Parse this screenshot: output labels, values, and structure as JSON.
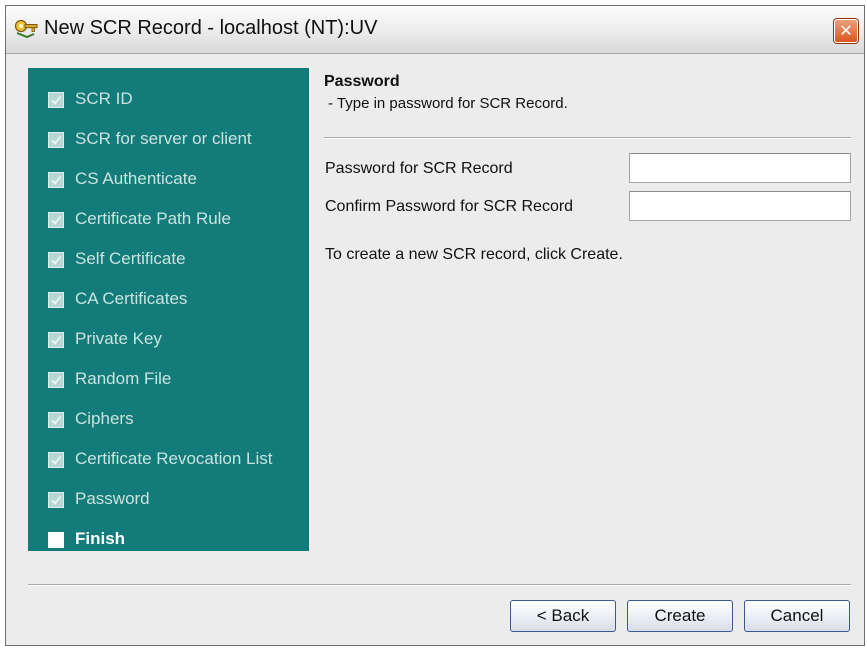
{
  "window": {
    "title": "New SCR Record - localhost (NT):UV",
    "close_glyph": "✕"
  },
  "icons": {
    "app": "key-icon",
    "close": "close-icon",
    "checkbox": "checkmark-icon"
  },
  "colors": {
    "steps_panel": "#137c7a",
    "close_button": "#d9541f",
    "button_border": "#3a5a92"
  },
  "steps": [
    {
      "label": "SCR ID",
      "checked": true
    },
    {
      "label": "SCR for server or client",
      "checked": true
    },
    {
      "label": "CS Authenticate",
      "checked": true
    },
    {
      "label": "Certificate Path Rule",
      "checked": true
    },
    {
      "label": "Self Certificate",
      "checked": true
    },
    {
      "label": "CA Certificates",
      "checked": true
    },
    {
      "label": "Private Key",
      "checked": true
    },
    {
      "label": "Random File",
      "checked": true
    },
    {
      "label": "Ciphers",
      "checked": true
    },
    {
      "label": "Certificate Revocation List",
      "checked": true
    },
    {
      "label": "Password",
      "checked": true
    },
    {
      "label": "Finish",
      "checked": false
    }
  ],
  "panel": {
    "title": "Password",
    "description": "- Type in password for SCR Record.",
    "password_label": "Password for SCR Record",
    "password_value": "",
    "confirm_label": "Confirm Password for SCR Record",
    "confirm_value": "",
    "hint": "To create a new SCR record, click Create."
  },
  "buttons": {
    "back": "< Back",
    "create": "Create",
    "cancel": "Cancel"
  }
}
